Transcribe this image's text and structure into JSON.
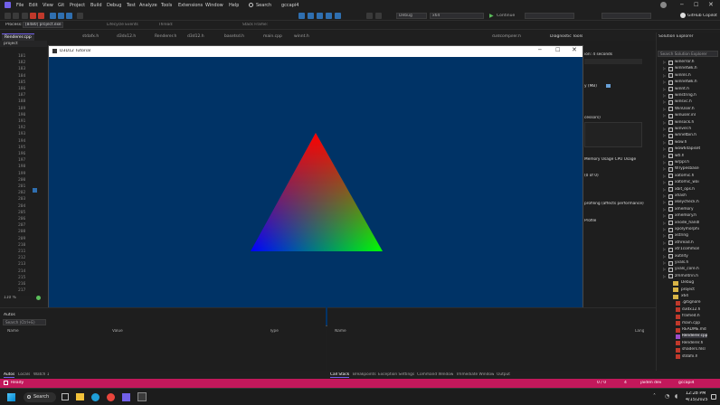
{
  "menu": {
    "items": [
      "File",
      "Edit",
      "View",
      "Git",
      "Project",
      "Build",
      "Debug",
      "Test",
      "Analyze",
      "Tools",
      "Extensions",
      "Window",
      "Help"
    ],
    "search_label": "Search",
    "solution_name": "gccapi4"
  },
  "toolbar": {
    "config_combo": "Debug",
    "platform_combo": "x64",
    "continue_label": "Continue",
    "copilot_label": "GitHub Copilot"
  },
  "processbar": {
    "process_label": "Process:",
    "process_value": "[8480] project.exe",
    "lifecycle_label": "Lifecycle Events",
    "thread_label": "Thread:",
    "stackframe_label": "Stack Frame:"
  },
  "tabs": [
    {
      "label": "Renderer.cpp",
      "active": true
    },
    {
      "label": "stdafx.h",
      "active": false
    },
    {
      "label": "d3dx12.h",
      "active": false
    },
    {
      "label": "Renderer.h",
      "active": false
    },
    {
      "label": "d3d12.h",
      "active": false
    },
    {
      "label": "basetsd.h",
      "active": false
    },
    {
      "label": "main.cpp",
      "active": false
    },
    {
      "label": "winnt.h",
      "active": false
    }
  ],
  "left_pane": {
    "title": "project",
    "line_numbers": [
      "181",
      "182",
      "183",
      "184",
      "185",
      "186",
      "187",
      "188",
      "189",
      "190",
      "191",
      "192",
      "193",
      "194",
      "195",
      "196",
      "197",
      "198",
      "199",
      "200",
      "201",
      "202",
      "203",
      "204",
      "205",
      "206",
      "207",
      "208",
      "209",
      "210",
      "211",
      "212",
      "213",
      "214",
      "215",
      "216",
      "217"
    ],
    "zoom": "110 %"
  },
  "diagnostics": {
    "title": "Diagnostic Tools",
    "session_text": "ion: 4 seconds",
    "memory_label": "y (MB)",
    "events_label": "cessors)",
    "tabs_text": "Memory Usage   CPU Usage",
    "events_count": "(0 of 0)",
    "cpu_note": "profiling (affects performance)",
    "profile_label": "Profile",
    "tab_right": "d3dcompiler.h"
  },
  "appwin": {
    "title": "D3D12 Tutorial",
    "bg_color": "#003366",
    "triangle_colors": {
      "top": "#ff0000",
      "right": "#00ff00",
      "left": "#0000ff"
    }
  },
  "solution_explorer": {
    "title": "Solution Explorer",
    "search_placeholder": "Search Solution Explorer",
    "files": [
      "winerror.h",
      "winnetwk.h",
      "winnls.h",
      "winnetwk.h",
      "winnt.h",
      "winstring.h",
      "winsvc.h",
      "WinUser.h",
      "winuser.inl",
      "winsock.h",
      "winver.h",
      "wnnetbin.h",
      "wow.h",
      "wow64apiset",
      "wtl.h",
      "wrppl.h",
      "WTypesbase",
      "xatomic.h",
      "xatomic_wai",
      "xbit_ops.h",
      "xhash",
      "xkeycheck.h",
      "xmemory",
      "xmemory.h",
      "xnode_handl",
      "xpolymorphi",
      "xstring",
      "xthread.h",
      "xtr1common",
      "xutility",
      "yvals.h",
      "yvals_core.h",
      "zmmintrin.h"
    ],
    "folders": [
      "Debug",
      "project",
      "x64"
    ],
    "project_files": [
      ".gitignore",
      "d3dx12.h",
      "framed.h",
      "main.cpp",
      "README.md",
      "Renderer.cpp",
      "Renderer.h",
      "shaders.hlsl",
      "stdafx.h"
    ],
    "bottom_tabs": [
      "Solution Explo...",
      "Git Changes"
    ]
  },
  "autos": {
    "title": "Autos",
    "search_placeholder": "Search (Ctrl+E)",
    "col_name": "Name",
    "col_value": "Value",
    "col_type": "Type"
  },
  "callstack": {
    "col_name": "Name",
    "col_lang": "Lang"
  },
  "bottom_tabs_left": [
    "Autos",
    "Locals",
    "Watch 1"
  ],
  "bottom_tabs_right": [
    "Call Stack",
    "Breakpoints",
    "Exception Settings",
    "Command Window",
    "Immediate Window",
    "Output"
  ],
  "status": {
    "ready": "Ready",
    "position": "0 / 0",
    "errors": "4",
    "branch": "jaiden dev",
    "repo": "gccapi4"
  },
  "taskbar": {
    "search_label": "Search",
    "time": "12:28 PM",
    "date": "4/15/2025"
  },
  "colors": {
    "accent": "#7160e8",
    "status_bar": "#c2185b"
  }
}
